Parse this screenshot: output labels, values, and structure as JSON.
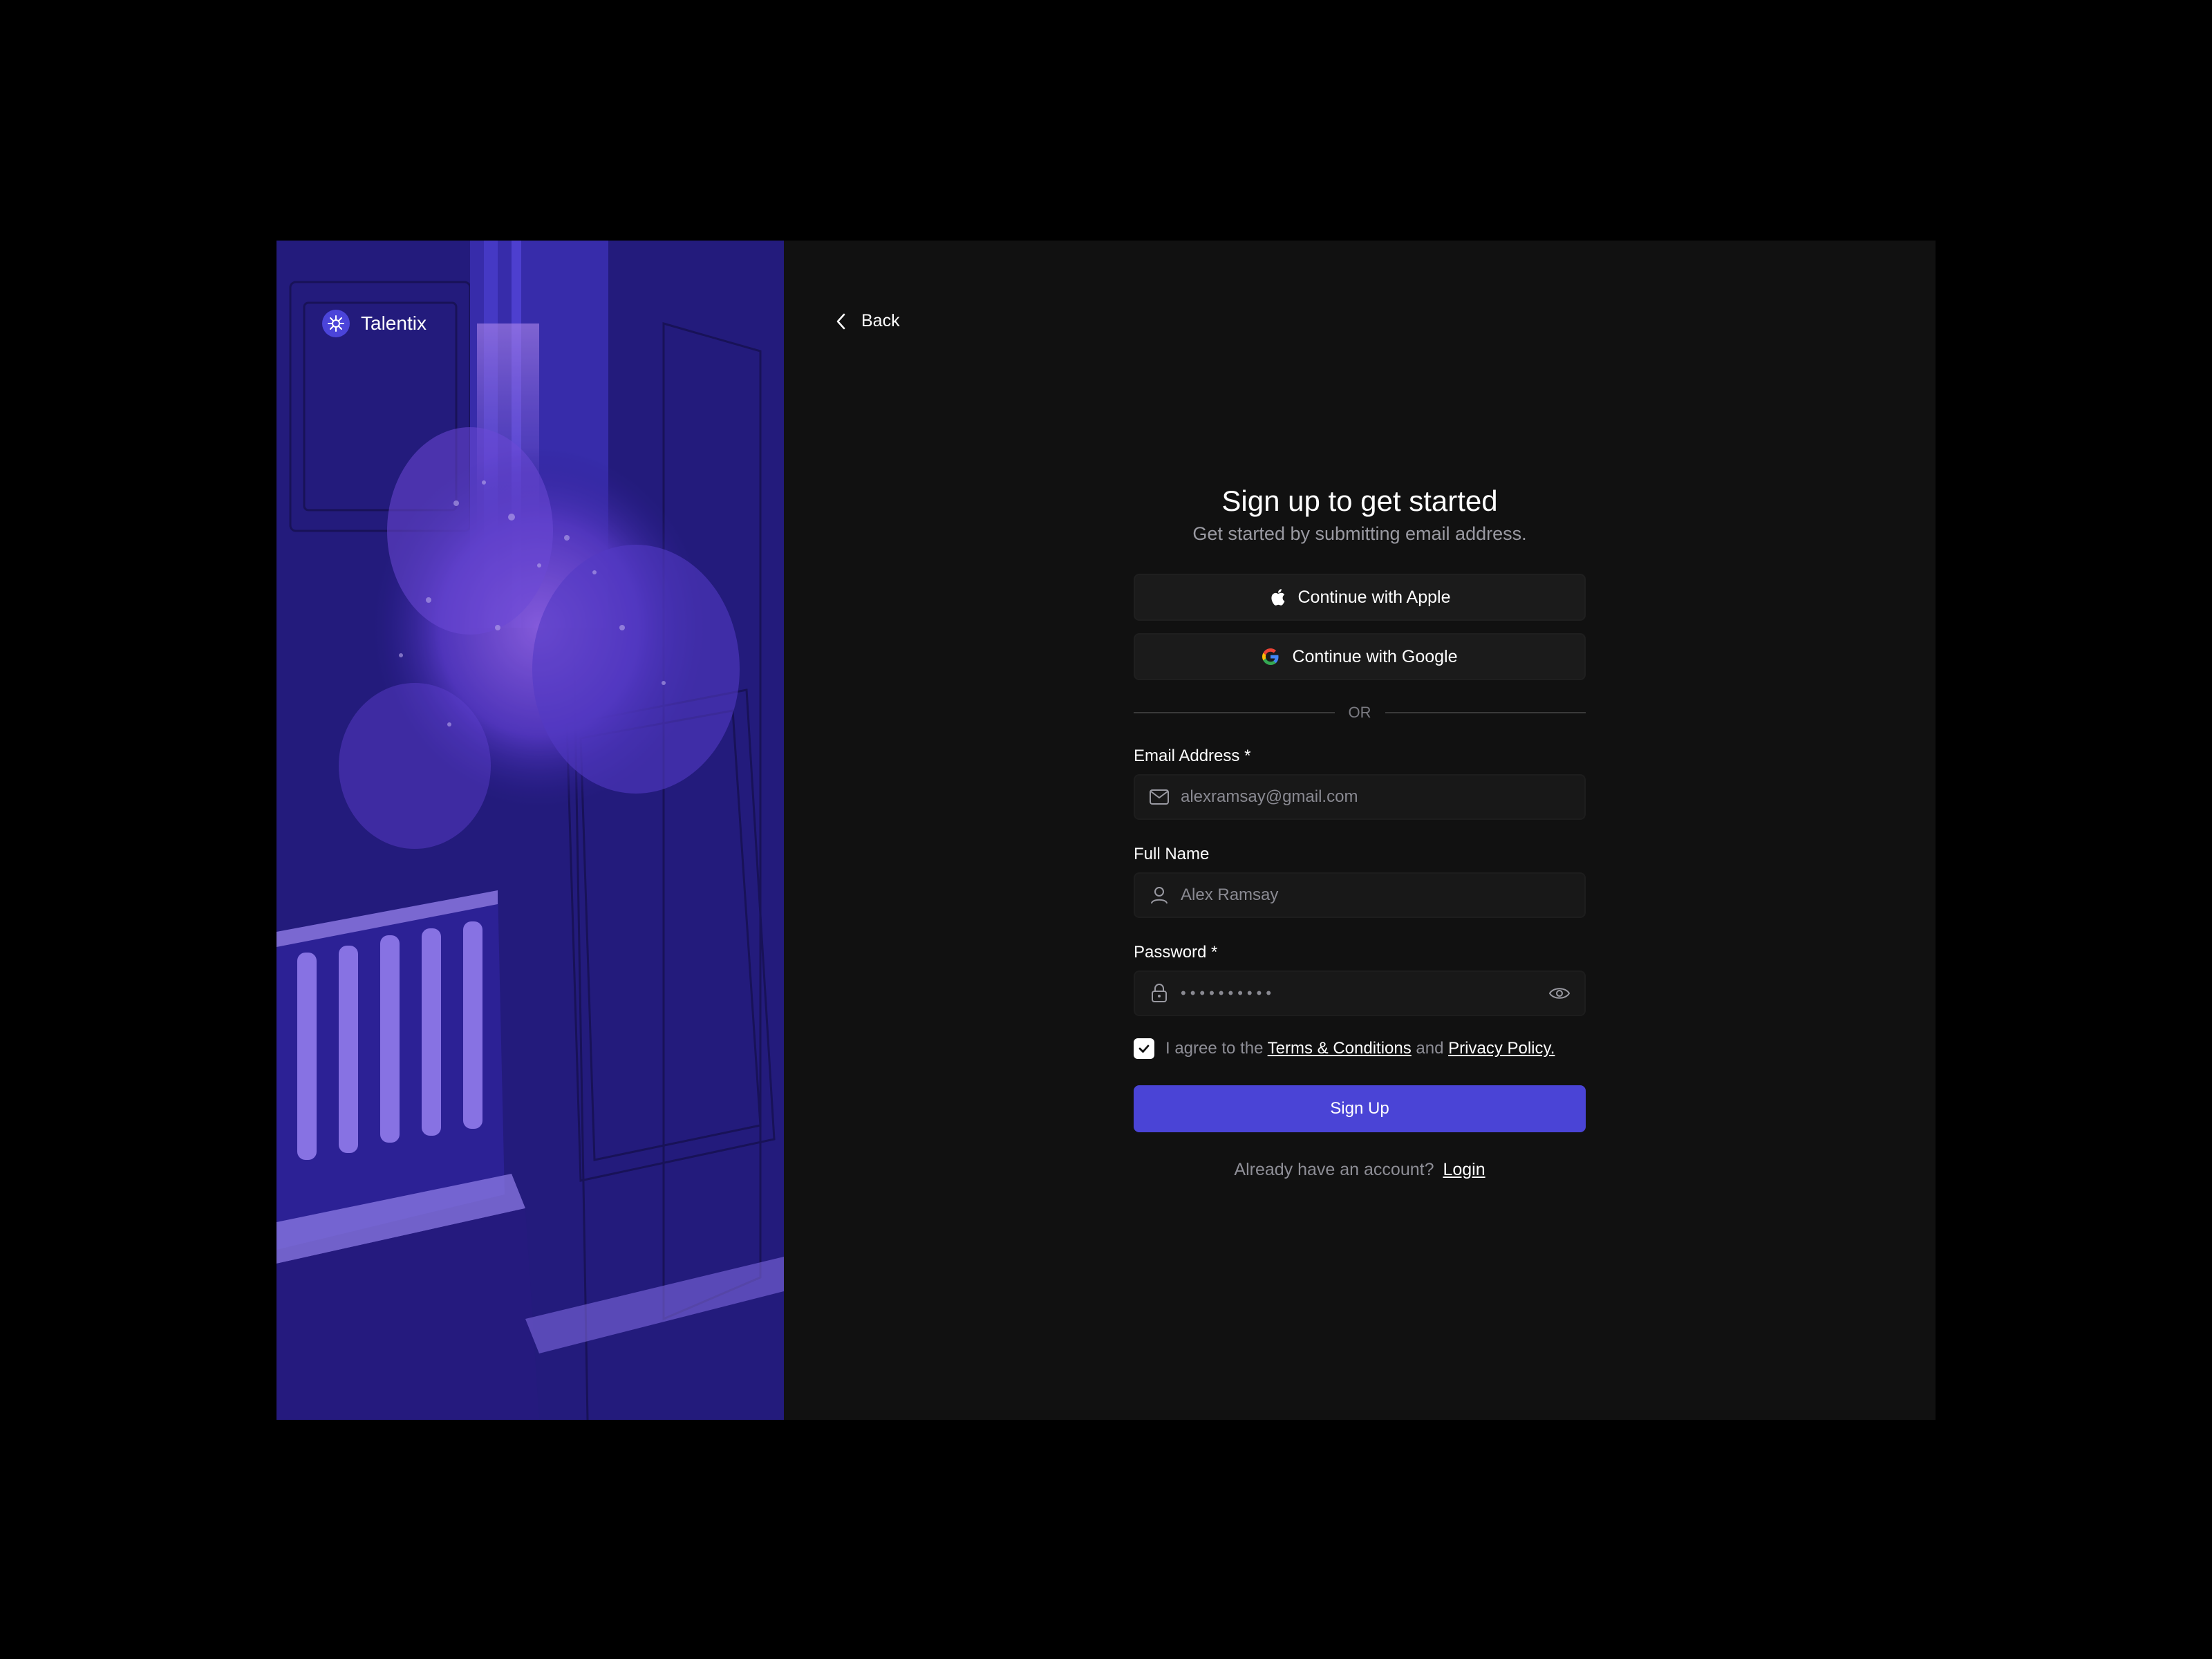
{
  "brand": {
    "name": "Talentix"
  },
  "nav": {
    "back_label": "Back"
  },
  "form": {
    "title": "Sign up to get started",
    "subtitle": "Get started by submitting email address.",
    "apple_label": "Continue with Apple",
    "google_label": "Continue with Google",
    "divider_label": "OR",
    "email": {
      "label": "Email Address",
      "required_mark": "*",
      "value": "alexramsay@gmail.com"
    },
    "name": {
      "label": "Full Name",
      "value": "Alex Ramsay"
    },
    "password": {
      "label": "Password",
      "required_mark": "*",
      "masked_value": "••••••••••"
    },
    "terms": {
      "prefix": "I agree to the",
      "terms_link": "Terms & Conditions",
      "conjunction": "and",
      "privacy_link": "Privacy Policy.",
      "checked": true
    },
    "submit_label": "Sign Up",
    "login_prompt": "Already have an account?",
    "login_link": "Login"
  },
  "colors": {
    "page_bg": "#000000",
    "panel_bg": "#111111",
    "accent": "#4a44d6",
    "art_primary": "#2b1f8f",
    "art_highlight": "#a987ff"
  },
  "icons": {
    "brand": "sparkle-logo-icon",
    "back": "chevron-left-icon",
    "apple": "apple-icon",
    "google": "google-icon",
    "email": "mail-icon",
    "name": "user-icon",
    "password": "lock-icon",
    "reveal": "eye-icon",
    "checkbox": "check-icon"
  }
}
